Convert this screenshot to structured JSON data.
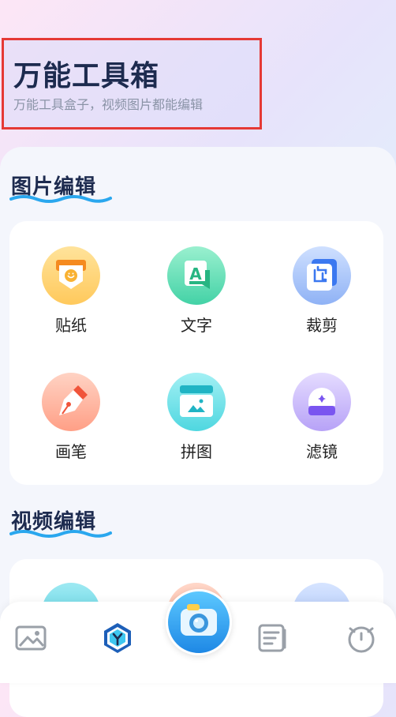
{
  "header": {
    "title": "万能工具箱",
    "subtitle": "万能工具盒子，视频图片都能编辑"
  },
  "sections": {
    "image_edit": {
      "title": "图片编辑",
      "tools": [
        {
          "label": "贴纸",
          "icon": "sticker-icon"
        },
        {
          "label": "文字",
          "icon": "text-icon"
        },
        {
          "label": "裁剪",
          "icon": "crop-icon"
        },
        {
          "label": "画笔",
          "icon": "pen-icon"
        },
        {
          "label": "拼图",
          "icon": "collage-icon"
        },
        {
          "label": "滤镜",
          "icon": "filter-icon"
        }
      ]
    },
    "video_edit": {
      "title": "视频编辑"
    }
  },
  "bottom_nav": {
    "items": [
      "gallery-icon",
      "tools-hex-icon",
      "camera-icon",
      "notes-icon",
      "clock-icon"
    ],
    "active": "tools-hex-icon"
  },
  "colors": {
    "title": "#1d2b4f",
    "highlight_border": "#e53935",
    "accent_blue": "#2aa7ee",
    "active_nav": "#1d5fb8"
  }
}
